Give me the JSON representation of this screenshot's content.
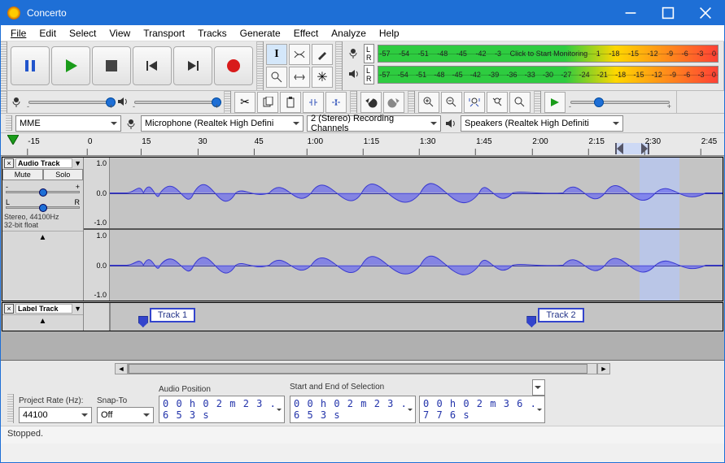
{
  "window": {
    "title": "Concerto"
  },
  "menu": [
    "File",
    "Edit",
    "Select",
    "View",
    "Transport",
    "Tracks",
    "Generate",
    "Effect",
    "Analyze",
    "Help"
  ],
  "meters": {
    "rec_ticks": [
      "-57",
      "-54",
      "-51",
      "-48",
      "-45",
      "-42",
      "-3",
      "Click to Start Monitoring",
      "1",
      "-18",
      "-15",
      "-12",
      "-9",
      "-6",
      "-3",
      "0"
    ],
    "play_ticks": [
      "-57",
      "-54",
      "-51",
      "-48",
      "-45",
      "-42",
      "-39",
      "-36",
      "-33",
      "-30",
      "-27",
      "-24",
      "-21",
      "-18",
      "-15",
      "-12",
      "-9",
      "-6",
      "-3",
      "0"
    ],
    "monitor_text": "Click to Start Monitoring"
  },
  "devices": {
    "host": "MME",
    "input": "Microphone (Realtek High Defini",
    "channels": "2 (Stereo) Recording Channels",
    "output": "Speakers (Realtek High Definiti"
  },
  "ruler": [
    "-15",
    "0",
    "15",
    "30",
    "45",
    "1:00",
    "1:15",
    "1:30",
    "1:45",
    "2:00",
    "2:15",
    "2:30",
    "2:45"
  ],
  "selection": {
    "start_pct": 86.5,
    "end_pct": 93.0
  },
  "audio_track": {
    "name": "Audio Track",
    "mute": "Mute",
    "solo": "Solo",
    "info1": "Stereo, 44100Hz",
    "info2": "32-bit float",
    "scale": [
      "1.0",
      "0.0",
      "-1.0"
    ]
  },
  "label_track": {
    "name": "Label Track",
    "labels": [
      {
        "text": "Track 1",
        "left_pct": 4.5
      },
      {
        "text": "Track 2",
        "left_pct": 68.0
      }
    ]
  },
  "status": {
    "project_rate_label": "Project Rate (Hz):",
    "project_rate": "44100",
    "snap_label": "Snap-To",
    "snap": "Off",
    "audio_pos_label": "Audio Position",
    "audio_pos": "0 0 h 0 2 m 2 3 . 6 5 3 s",
    "sel_label": "Start and End of Selection",
    "sel_start": "0 0 h 0 2 m 2 3 . 6 5 3 s",
    "sel_end": "0 0 h 0 2 m 3 6 . 7 7 6 s"
  },
  "footer": "Stopped."
}
